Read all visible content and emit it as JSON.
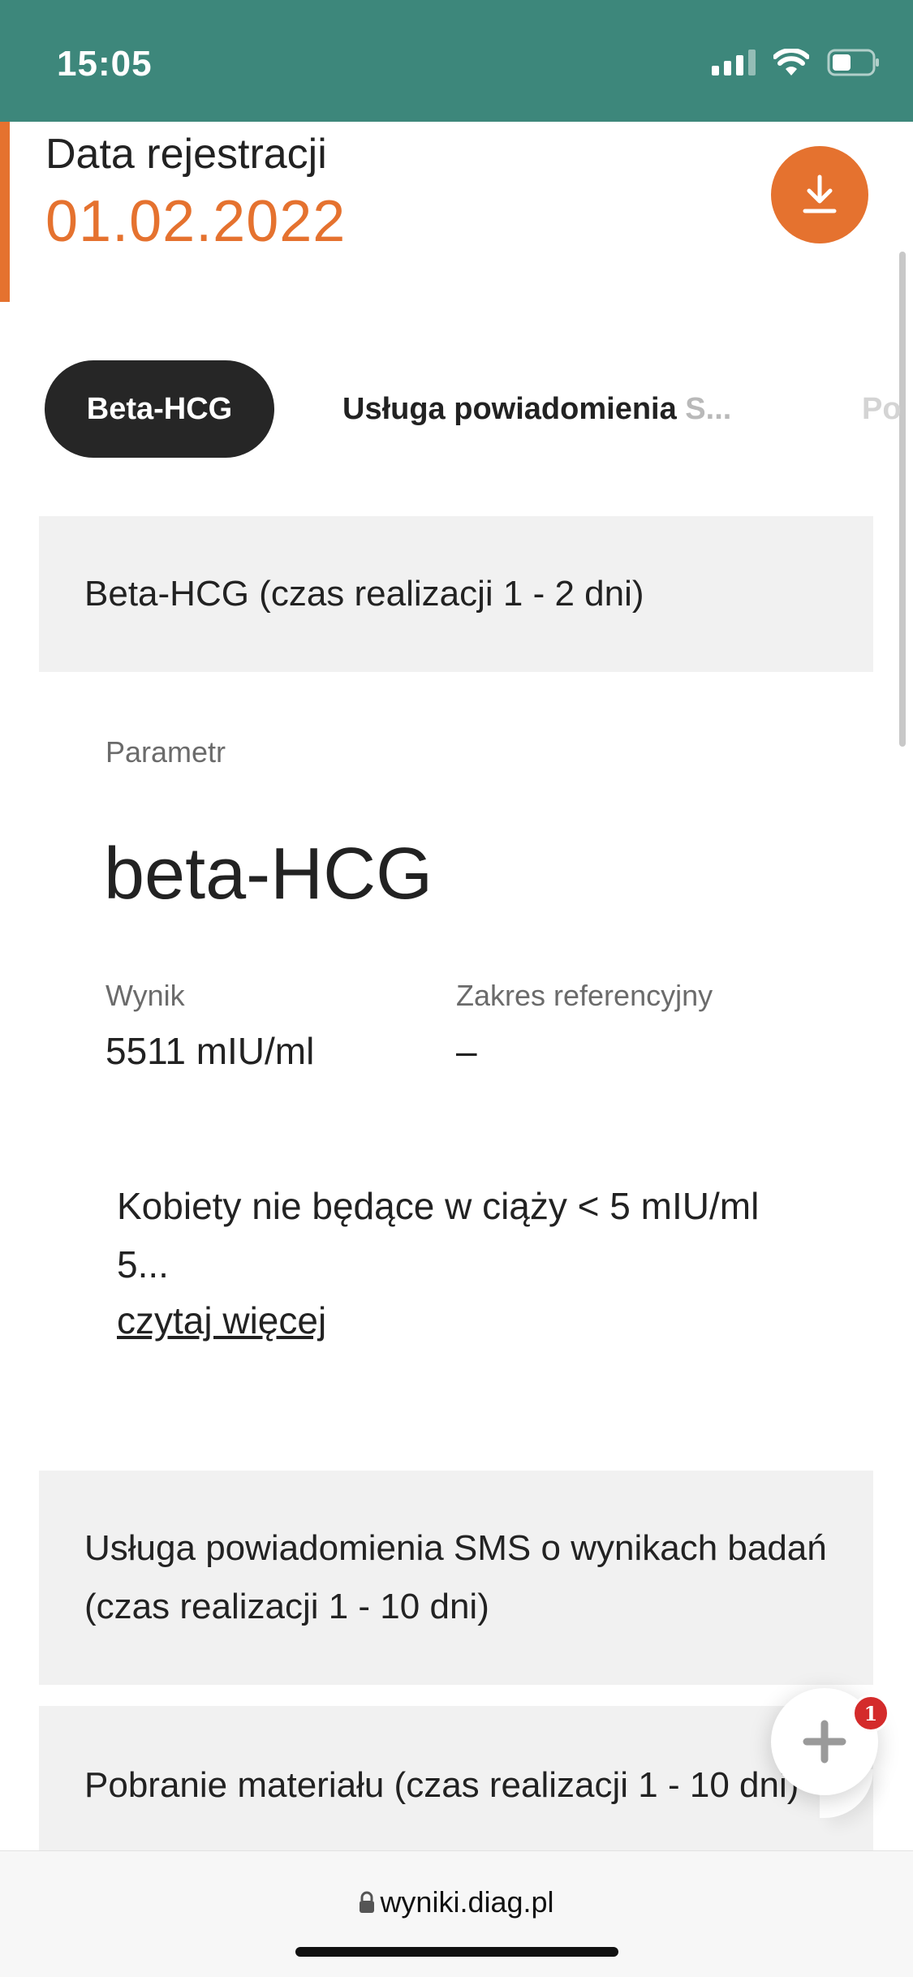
{
  "status_bar": {
    "time": "15:05"
  },
  "header": {
    "registration_label": "Data rejestracji",
    "registration_date": "01.02.2022"
  },
  "tabs": [
    {
      "label": "Beta-HCG",
      "active": true
    },
    {
      "label": "Usługa powiadomienia",
      "overflow": "S..."
    },
    {
      "label": "Po"
    }
  ],
  "sections": {
    "beta_hcg_title": "Beta-HCG (czas realizacji 1 - 2 dni)",
    "sms_title": "Usługa powiadomienia SMS o wynikach badań (czas realizacji 1 - 10 dni)",
    "material_title": "Pobranie materiału (czas realizacji 1 - 10 dni)"
  },
  "result": {
    "parameter_label": "Parametr",
    "parameter_name": "beta-HCG",
    "value_label": "Wynik",
    "value": "5511 mIU/ml",
    "reference_label": "Zakres referencyjny",
    "reference_value": "–",
    "note_line1": "Kobiety nie będące w ciąży < 5 mIU/ml",
    "note_line2": "5...",
    "read_more": "czytaj więcej"
  },
  "chat": {
    "badge_count": "1"
  },
  "browser": {
    "url": "wyniki.diag.pl"
  },
  "colors": {
    "accent": "#e5722f",
    "status_bar": "#3d877b",
    "tab_active": "#262626",
    "badge": "#d42b2b"
  }
}
